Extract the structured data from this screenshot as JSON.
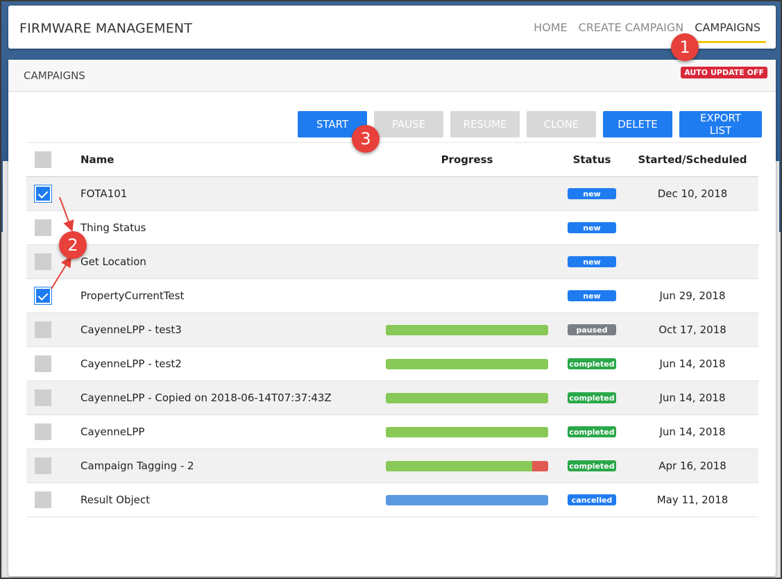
{
  "app": {
    "title": "FIRMWARE MANAGEMENT"
  },
  "nav": {
    "items": [
      {
        "label": "HOME",
        "active": false
      },
      {
        "label": "CREATE CAMPAIGN",
        "active": false
      },
      {
        "label": "CAMPAIGNS",
        "active": true
      }
    ]
  },
  "card": {
    "title": "CAMPAIGNS",
    "auto_update_badge": "AUTO UPDATE OFF"
  },
  "toolbar": {
    "start": "START",
    "pause": "PAUSE",
    "resume": "RESUME",
    "clone": "CLONE",
    "delete": "DELETE",
    "export": "EXPORT LIST"
  },
  "table": {
    "headers": {
      "name": "Name",
      "progress": "Progress",
      "status": "Status",
      "date": "Started/Scheduled"
    },
    "rows": [
      {
        "name": "FOTA101",
        "checked": true,
        "progress": null,
        "status": "new",
        "date": "Dec 10, 2018"
      },
      {
        "name": "Thing Status",
        "checked": false,
        "progress": null,
        "status": "new",
        "date": ""
      },
      {
        "name": "Get Location",
        "checked": false,
        "progress": null,
        "status": "new",
        "date": ""
      },
      {
        "name": "PropertyCurrentTest",
        "checked": true,
        "progress": null,
        "status": "new",
        "date": "Jun 29, 2018"
      },
      {
        "name": "CayenneLPP - test3",
        "checked": false,
        "progress": {
          "success": 1.0,
          "failed": 0.0
        },
        "status": "paused",
        "date": "Oct 17, 2018"
      },
      {
        "name": "CayenneLPP - test2",
        "checked": false,
        "progress": {
          "success": 1.0,
          "failed": 0.0
        },
        "status": "completed",
        "date": "Jun 14, 2018"
      },
      {
        "name": "CayenneLPP - Copied on 2018-06-14T07:37:43Z",
        "checked": false,
        "progress": {
          "success": 1.0,
          "failed": 0.0
        },
        "status": "completed",
        "date": "Jun 14, 2018"
      },
      {
        "name": "CayenneLPP",
        "checked": false,
        "progress": {
          "success": 1.0,
          "failed": 0.0
        },
        "status": "completed",
        "date": "Jun 14, 2018"
      },
      {
        "name": "Campaign Tagging - 2",
        "checked": false,
        "progress": {
          "success": 0.9,
          "failed": 0.1
        },
        "status": "completed",
        "date": "Apr 16, 2018"
      },
      {
        "name": "Result Object",
        "checked": false,
        "progress": {
          "cancelled": 1.0
        },
        "status": "cancelled",
        "date": "May 11, 2018"
      }
    ]
  },
  "colors": {
    "accent": "#1f7cf0",
    "progress_success": "#88c957",
    "progress_failed": "#e05a52",
    "progress_cancelled": "#5b9ae0",
    "nav_underline": "#f1c40f",
    "marker": "#e8403a"
  },
  "annotations": {
    "markers": [
      "1",
      "2",
      "3"
    ]
  }
}
